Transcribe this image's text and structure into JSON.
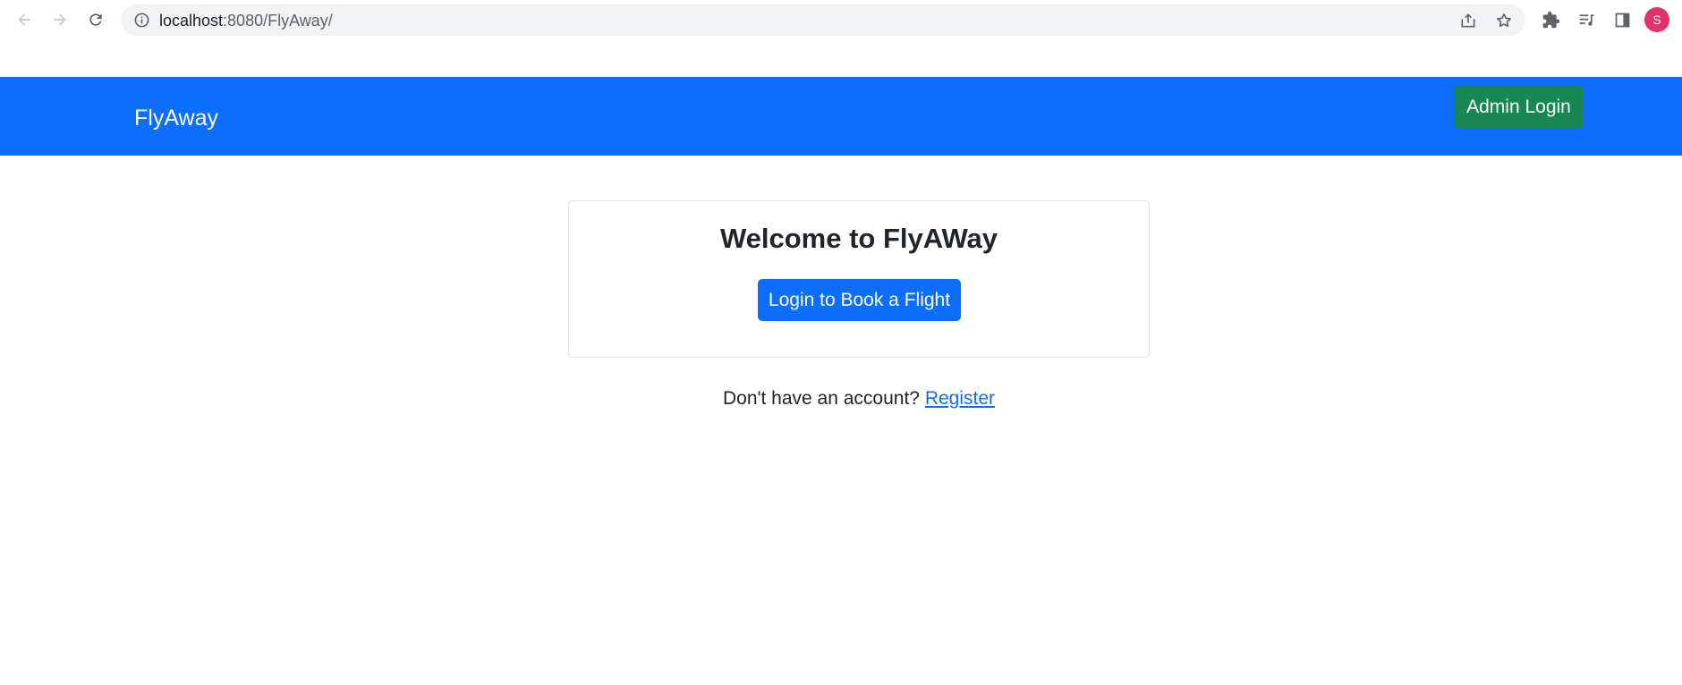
{
  "browser": {
    "url_host": "localhost",
    "url_rest": ":8080/FlyAway/",
    "profile_initial": "S",
    "icons": [
      "back-icon",
      "forward-icon",
      "reload-icon",
      "site-info-icon",
      "share-icon",
      "bookmark-star-icon",
      "extensions-icon",
      "reading-list-icon",
      "side-panel-icon"
    ]
  },
  "navbar": {
    "brand": "FlyAway",
    "admin_login": "Admin Login",
    "color": "#0d6efd",
    "admin_color": "#198754"
  },
  "card": {
    "title": "Welcome to FlyAWay",
    "login_button": "Login to Book a Flight"
  },
  "register": {
    "prompt": "Don't have an account?",
    "link": "Register"
  }
}
